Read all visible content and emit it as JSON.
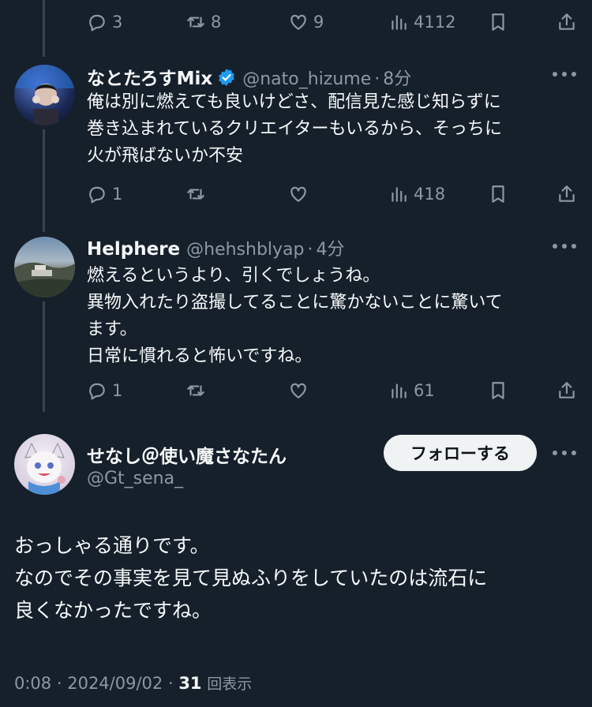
{
  "top_actions": {
    "reply": "3",
    "retweet": "8",
    "like": "9",
    "views": "4112"
  },
  "replies": [
    {
      "name": "なとたろすMix",
      "handle": "@nato_hizume",
      "time": "8分",
      "verified": true,
      "text": "俺は別に燃えても良いけどさ、配信見た感じ知らずに\n巻き込まれているクリエイターもいるから、そっちに\n火が飛ばないか不安",
      "reply_count": "1",
      "views": "418"
    },
    {
      "name": "Helphere",
      "handle": "@hehshblyap",
      "time": "4分",
      "verified": false,
      "text": "燃えるというより、引くでしょうね。\n異物入れたり盗撮してることに驚かないことに驚いて\nます。\n日常に慣れると怖いですね。",
      "reply_count": "1",
      "views": "61"
    }
  ],
  "main_tweet": {
    "name": "せなし＠使い魔さなたん",
    "handle": "@Gt_sena_",
    "follow_label": "フォローする",
    "text": "おっしゃる通りです。\nなのでその事実を見て見ぬふりをしていたのは流石に\n良くなかったですね。",
    "time": "0:08",
    "date": "2024/09/02",
    "views_count": "31",
    "views_label": "回表示"
  },
  "colors": {
    "background": "#15202b",
    "verified": "#1d9bf0",
    "muted": "#8b98a5"
  }
}
